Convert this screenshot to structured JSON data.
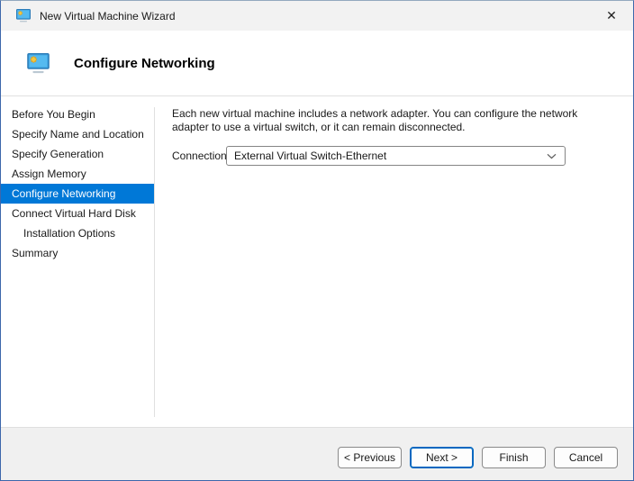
{
  "window": {
    "title": "New Virtual Machine Wizard",
    "close_glyph": "✕"
  },
  "header": {
    "title": "Configure Networking"
  },
  "sidebar": {
    "items": [
      {
        "name": "sidebar-item-before-you-begin",
        "label": "Before You Begin",
        "selected": false,
        "indent": false
      },
      {
        "name": "sidebar-item-specify-name-and-location",
        "label": "Specify Name and Location",
        "selected": false,
        "indent": false
      },
      {
        "name": "sidebar-item-specify-generation",
        "label": "Specify Generation",
        "selected": false,
        "indent": false
      },
      {
        "name": "sidebar-item-assign-memory",
        "label": "Assign Memory",
        "selected": false,
        "indent": false
      },
      {
        "name": "sidebar-item-configure-networking",
        "label": "Configure Networking",
        "selected": true,
        "indent": false
      },
      {
        "name": "sidebar-item-connect-virtual-hard-disk",
        "label": "Connect Virtual Hard Disk",
        "selected": false,
        "indent": false
      },
      {
        "name": "sidebar-item-installation-options",
        "label": "Installation Options",
        "selected": false,
        "indent": true
      },
      {
        "name": "sidebar-item-summary",
        "label": "Summary",
        "selected": false,
        "indent": false
      }
    ]
  },
  "main": {
    "description": "Each new virtual machine includes a network adapter. You can configure the network adapter to use a virtual switch, or it can remain disconnected.",
    "connection_label": "Connection:",
    "connection_value": "External Virtual Switch-Ethernet"
  },
  "footer": {
    "buttons": [
      {
        "name": "previous-button",
        "label": "< Previous",
        "default": false
      },
      {
        "name": "next-button",
        "label": "Next >",
        "default": true
      },
      {
        "name": "finish-button",
        "label": "Finish",
        "default": false
      },
      {
        "name": "cancel-button",
        "label": "Cancel",
        "default": false
      }
    ]
  },
  "colors": {
    "accent": "#0078d7",
    "next_button_border": "#0067c0",
    "titlebar_bg": "#f2f2f2",
    "footer_bg": "#f0f0f0"
  }
}
